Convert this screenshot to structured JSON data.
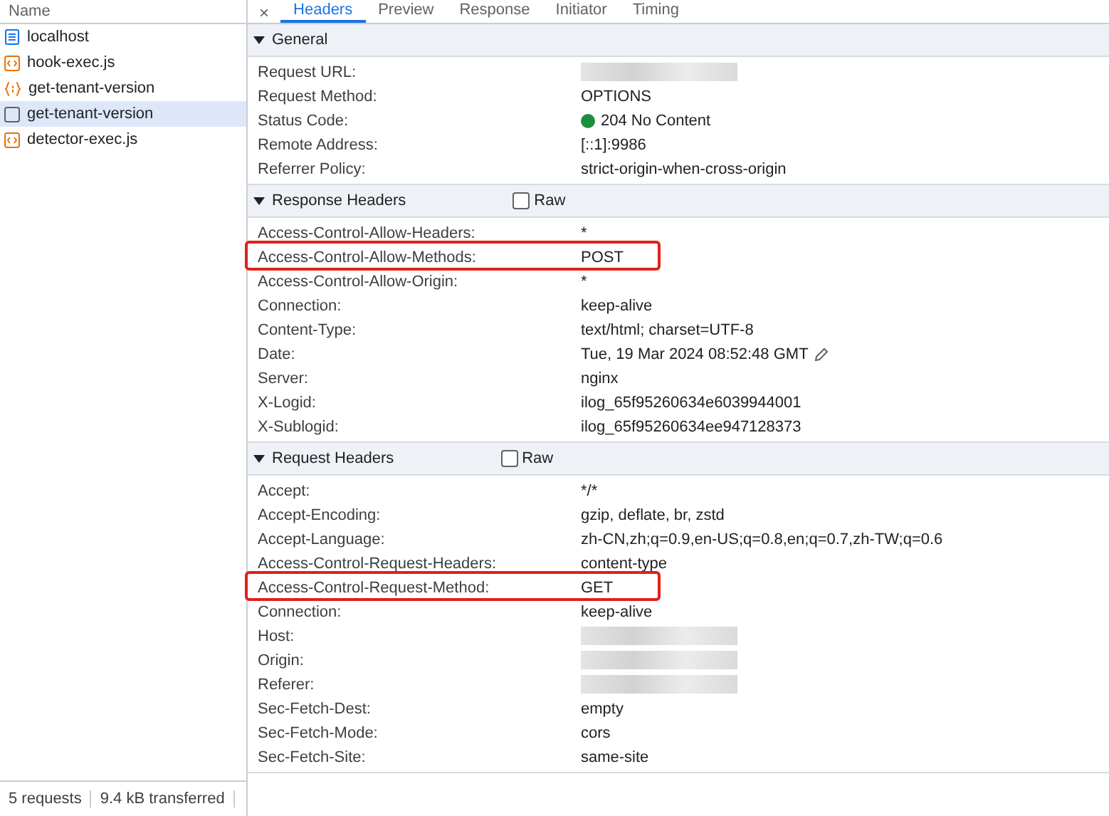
{
  "sidebar": {
    "header": "Name",
    "items": [
      {
        "label": "localhost",
        "kind": "document",
        "selected": false
      },
      {
        "label": "hook-exec.js",
        "kind": "script",
        "selected": false
      },
      {
        "label": "get-tenant-version",
        "kind": "fetch",
        "selected": false
      },
      {
        "label": "get-tenant-version",
        "kind": "preflight",
        "selected": true
      },
      {
        "label": "detector-exec.js",
        "kind": "script",
        "selected": false
      }
    ],
    "status": [
      "5 requests",
      "9.4 kB transferred"
    ]
  },
  "tabs": [
    {
      "label": "Headers",
      "selected": true
    },
    {
      "label": "Preview",
      "selected": false
    },
    {
      "label": "Response",
      "selected": false
    },
    {
      "label": "Initiator",
      "selected": false
    },
    {
      "label": "Timing",
      "selected": false
    }
  ],
  "close_label": "×",
  "sections": [
    {
      "title": "General",
      "expanded": true,
      "rows": [
        {
          "name": "Request URL:",
          "redacted": true
        },
        {
          "name": "Request Method:",
          "value": "OPTIONS"
        },
        {
          "name": "Status Code:",
          "value": "204 No Content",
          "color": "#1e8e3e"
        },
        {
          "name": "Remote Address:",
          "value": "[::1]:9986"
        },
        {
          "name": "Referrer Policy:",
          "value": "strict-origin-when-cross-origin"
        }
      ]
    },
    {
      "title": "Response Headers",
      "expanded": true,
      "raw": {
        "label": "Raw",
        "checked": false
      },
      "rows": [
        {
          "name": "Access-Control-Allow-Headers:",
          "value": "*"
        },
        {
          "name": "Access-Control-Allow-Methods:",
          "value": "POST",
          "highlighted": true
        },
        {
          "name": "Access-Control-Allow-Origin:",
          "value": "*"
        },
        {
          "name": "Connection:",
          "value": "keep-alive"
        },
        {
          "name": "Content-Type:",
          "value": "text/html; charset=UTF-8"
        },
        {
          "name": "Date:",
          "value": "Tue, 19 Mar 2024 08:52:48 GMT",
          "editable": true
        },
        {
          "name": "Server:",
          "value": "nginx"
        },
        {
          "name": "X-Logid:",
          "value": "ilog_65f95260634e6039944001"
        },
        {
          "name": "X-Sublogid:",
          "value": "ilog_65f95260634ee947128373"
        }
      ]
    },
    {
      "title": "Request Headers",
      "expanded": true,
      "raw": {
        "label": "Raw",
        "checked": false
      },
      "rows": [
        {
          "name": "Accept:",
          "value": "*/*"
        },
        {
          "name": "Accept-Encoding:",
          "value": "gzip, deflate, br, zstd"
        },
        {
          "name": "Accept-Language:",
          "value": "zh-CN,zh;q=0.9,en-US;q=0.8,en;q=0.7,zh-TW;q=0.6"
        },
        {
          "name": "Access-Control-Request-Headers:",
          "value": "content-type"
        },
        {
          "name": "Access-Control-Request-Method:",
          "value": "GET",
          "highlighted": true
        },
        {
          "name": "Connection:",
          "value": "keep-alive"
        },
        {
          "name": "Host:",
          "redacted": true
        },
        {
          "name": "Origin:",
          "redacted": true
        },
        {
          "name": "Referer:",
          "redacted": true
        },
        {
          "name": "Sec-Fetch-Dest:",
          "value": "empty"
        },
        {
          "name": "Sec-Fetch-Mode:",
          "value": "cors"
        },
        {
          "name": "Sec-Fetch-Site:",
          "value": "same-site"
        }
      ]
    }
  ]
}
